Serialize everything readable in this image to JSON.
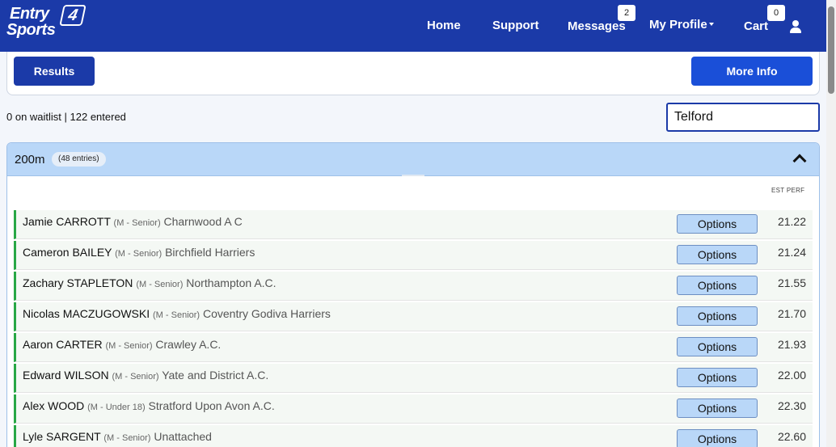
{
  "header": {
    "logo_top": "Entry",
    "logo_four": "4",
    "logo_bottom": "Sports",
    "nav": {
      "home": "Home",
      "support": "Support",
      "messages": "Messages",
      "messages_count": "2",
      "profile": "My Profile",
      "cart": "Cart",
      "cart_count": "0"
    }
  },
  "actions": {
    "results_label": "Results",
    "more_info_label": "More Info"
  },
  "stats": "0 on waitlist | 122 entered",
  "search": {
    "value": "Telford"
  },
  "event": {
    "name": "200m",
    "entries": "(48 entries)",
    "perf_header": "EST PERF",
    "options_label": "Options",
    "rows": [
      {
        "name": "Jamie CARROTT",
        "category": "(M - Senior)",
        "club": "Charnwood A C",
        "perf": "21.22"
      },
      {
        "name": "Cameron BAILEY",
        "category": "(M - Senior)",
        "club": "Birchfield Harriers",
        "perf": "21.24"
      },
      {
        "name": "Zachary STAPLETON",
        "category": "(M - Senior)",
        "club": "Northampton A.C.",
        "perf": "21.55"
      },
      {
        "name": "Nicolas MACZUGOWSKI",
        "category": "(M - Senior)",
        "club": "Coventry Godiva Harriers",
        "perf": "21.70"
      },
      {
        "name": "Aaron CARTER",
        "category": "(M - Senior)",
        "club": "Crawley A.C.",
        "perf": "21.93"
      },
      {
        "name": "Edward WILSON",
        "category": "(M - Senior)",
        "club": "Yate and District A.C.",
        "perf": "22.00"
      },
      {
        "name": "Alex WOOD",
        "category": "(M - Under 18)",
        "club": "Stratford Upon Avon A.C.",
        "perf": "22.30"
      },
      {
        "name": "Lyle SARGENT",
        "category": "(M - Senior)",
        "club": "Unattached",
        "perf": "22.60"
      }
    ]
  },
  "colors": {
    "brand": "#1b3aa8",
    "accent": "#1a4fd8",
    "panel_header": "#b9d7f8",
    "confirmed": "#28a745"
  }
}
